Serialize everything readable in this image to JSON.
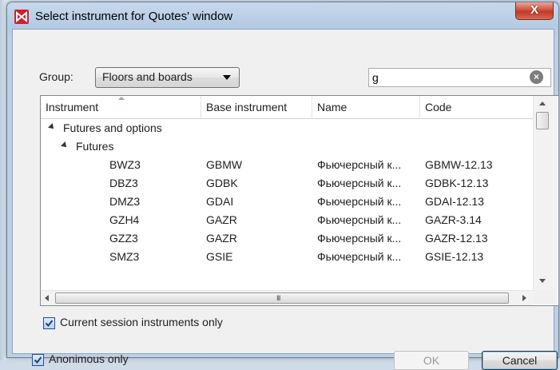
{
  "window": {
    "title": "Select instrument for Quotes' window",
    "close_label": "X",
    "brand_color": "#d11f2c"
  },
  "group": {
    "label": "Group:",
    "selected": "Floors and boards"
  },
  "search": {
    "value": "g",
    "clear_glyph": "×"
  },
  "table": {
    "columns": [
      "Instrument",
      "Base instrument",
      "Name",
      "Code"
    ],
    "tree": {
      "root": "Futures and options",
      "child": "Futures"
    },
    "rows": [
      {
        "instrument": "BWZ3",
        "base": "GBMW",
        "name": "Фьючерсный к...",
        "code": "GBMW-12.13"
      },
      {
        "instrument": "DBZ3",
        "base": "GDBK",
        "name": "Фьючерсный к...",
        "code": "GDBK-12.13"
      },
      {
        "instrument": "DMZ3",
        "base": "GDAI",
        "name": "Фьючерсный к...",
        "code": "GDAI-12.13"
      },
      {
        "instrument": "GZH4",
        "base": "GAZR",
        "name": "Фьючерсный к...",
        "code": "GAZR-3.14"
      },
      {
        "instrument": "GZZ3",
        "base": "GAZR",
        "name": "Фьючерсный к...",
        "code": "GAZR-12.13"
      },
      {
        "instrument": "SMZ3",
        "base": "GSIE",
        "name": "Фьючерсный к...",
        "code": "GSIE-12.13"
      }
    ],
    "hscroll_grip": "III"
  },
  "options": {
    "current_session_label": "Current session instruments only",
    "current_session_checked": true,
    "anonymous_label": "Anonimous only",
    "anonymous_checked": true
  },
  "buttons": {
    "ok_label": "OK",
    "ok_enabled": false,
    "cancel_label": "Cancel"
  }
}
